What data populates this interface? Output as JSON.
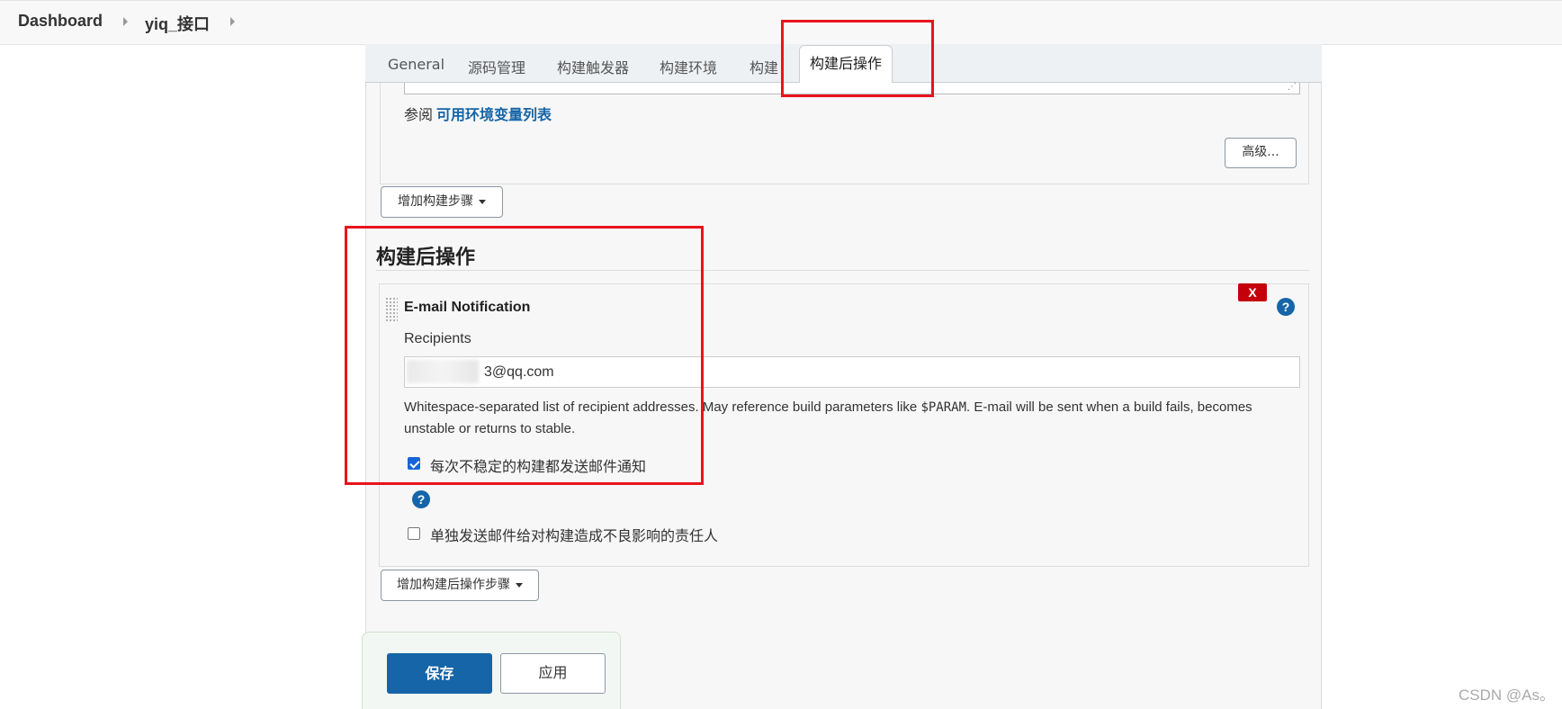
{
  "breadcrumb": {
    "items": [
      "Dashboard",
      "yiq_接口"
    ]
  },
  "tabs": {
    "items": [
      "General",
      "源码管理",
      "构建触发器",
      "构建环境",
      "构建"
    ],
    "active": "构建后操作"
  },
  "build_section": {
    "see_prefix": "参阅",
    "env_link": "可用环境变量列表",
    "advanced_label": "高级...",
    "add_step_label": "增加构建步骤"
  },
  "post_build": {
    "title": "构建后操作",
    "email": {
      "title": "E-mail Notification",
      "delete_label": "X",
      "help_label": "?",
      "recipients_label": "Recipients",
      "recipients_value": "3@qq.com",
      "desc_prefix": "Whitespace-separated list of recipient addresses. May reference build parameters like ",
      "desc_code": "$PARAM",
      "desc_suffix": ". E-mail will be sent when a build fails, becomes unstable or returns to stable.",
      "unstable_label": "每次不稳定的构建都发送邮件通知",
      "unstable_checked": true,
      "individual_label": "单独发送邮件给对构建造成不良影响的责任人",
      "individual_checked": false
    },
    "add_step_label": "增加构建后操作步骤"
  },
  "actions": {
    "save_label": "保存",
    "apply_label": "应用"
  },
  "watermark": "CSDN @As。",
  "colors": {
    "primary": "#1565a8",
    "delete": "#c4000a",
    "highlight": "#e8141c"
  }
}
